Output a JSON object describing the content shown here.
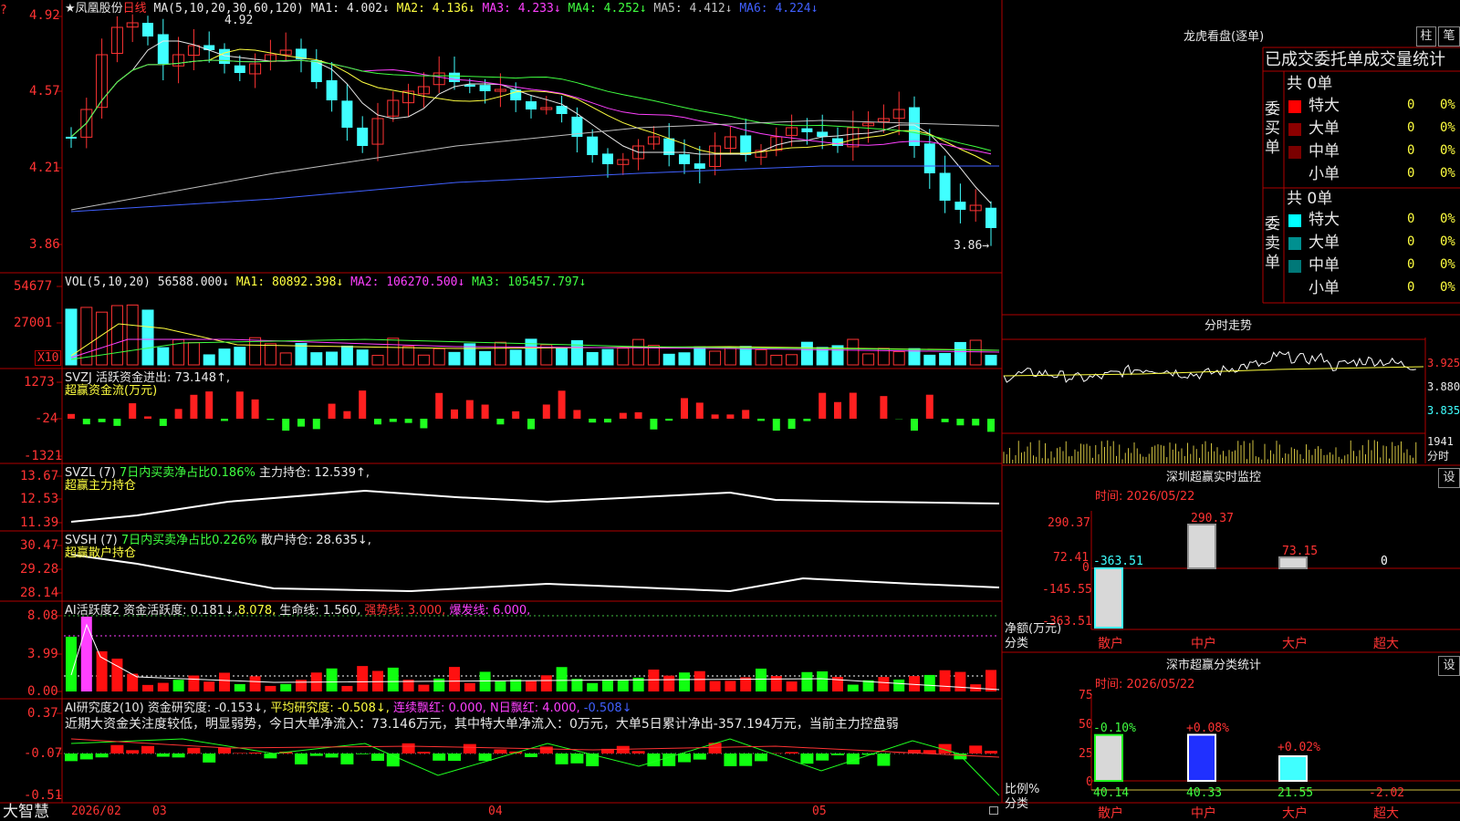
{
  "stock": {
    "title": "凤凰股份",
    "period": "日线",
    "star": "★",
    "ma_label": "MA(5,10,20,30,60,120)",
    "ma_values": [
      {
        "label": "MA1: 4.002↓",
        "color": "#e8e8e8"
      },
      {
        "label": "MA2: 4.136↓",
        "color": "#ffff40"
      },
      {
        "label": "MA3: 4.233↓",
        "color": "#ff40ff"
      },
      {
        "label": "MA4: 4.252↓",
        "color": "#40ff40"
      },
      {
        "label": "MA5: 4.412↓",
        "color": "#c0c0c0"
      },
      {
        "label": "MA6: 4.224↓",
        "color": "#4060ff"
      }
    ],
    "high_marker": "4.92",
    "low_marker": "3.86→",
    "price_axis": [
      "4.92",
      "4.57",
      "4.21",
      "3.86"
    ],
    "top_left_mark": "?"
  },
  "vol": {
    "label": "VOL(5,10,20)",
    "value": "56588.000↓",
    "ma1": "MA1: 80892.398↓",
    "ma2": "MA2: 106270.500↓",
    "ma3": "MA3: 105457.797↓",
    "axis": [
      "54677",
      "27001"
    ],
    "unit": "X10"
  },
  "svzj": {
    "label": "SVZJ  活跃资金进出: 73.148↑,",
    "sub": "超赢资金流(万元)",
    "axis": [
      "1273",
      "-24",
      "-1321"
    ]
  },
  "svzl": {
    "label": "SVZL (7)",
    "pct": "7日内买卖净占比0.186%",
    "hold": "主力持仓: 12.539↑,",
    "sub": "超赢主力持仓",
    "axis": [
      "13.67",
      "12.53",
      "11.39"
    ]
  },
  "svsh": {
    "label": "SVSH (7)",
    "pct": "7日内买卖净占比0.226%",
    "hold": "散户持仓: 28.635↓,",
    "sub": "超赢散户持仓",
    "axis": [
      "30.47",
      "29.28",
      "28.14"
    ]
  },
  "ai1": {
    "label": "AI活跃度2",
    "a": "资金活跃度: 0.181↓,",
    "b": "8.078,",
    "c": "生命线: 1.560,",
    "d": "强势线: 3.000,",
    "e": "爆发线: 6.000,",
    "axis": [
      "8.08",
      "3.99",
      "0.00"
    ]
  },
  "ai2": {
    "label": "AI研究度2(10)",
    "a": "资金研究度: -0.153↓,",
    "b": "平均研究度: -0.508↓,",
    "c": "连续飘红: 0.000,",
    "d": "N日飘红: 4.000,",
    "e": "-0.508↓",
    "note": "近期大资金关注度较低，明显弱势，今日大单净流入：73.146万元，其中特大单净流入：0万元，大单5日累计净出-357.194万元，当前主力控盘弱",
    "axis": [
      "0.37",
      "-0.07",
      "-0.51"
    ]
  },
  "bottom": {
    "brand": "大智慧",
    "dates": [
      "2026/02",
      "03",
      "04",
      "05"
    ]
  },
  "dragon": {
    "title": "龙虎看盘(逐单)",
    "btn1": "柱",
    "btn2": "笔",
    "subtitle": "已成交委托单成交量统计",
    "buy_label": "委买单",
    "sell_label": "委卖单",
    "buy_total": "共 0单",
    "sell_total": "共 0单",
    "buy_rows": [
      {
        "name": "特大",
        "count": "0",
        "pct": "0%",
        "color": "#ff0000"
      },
      {
        "name": "大单",
        "count": "0",
        "pct": "0%",
        "color": "#8b0000"
      },
      {
        "name": "中单",
        "count": "0",
        "pct": "0%",
        "color": "#7a0000"
      },
      {
        "name": "小单",
        "count": "0",
        "pct": "0%",
        "color": ""
      }
    ],
    "sell_rows": [
      {
        "name": "特大",
        "count": "0",
        "pct": "0%",
        "color": "#00ffff"
      },
      {
        "name": "大单",
        "count": "0",
        "pct": "0%",
        "color": "#009090"
      },
      {
        "name": "中单",
        "count": "0",
        "pct": "0%",
        "color": "#007878"
      },
      {
        "name": "小单",
        "count": "0",
        "pct": "0%",
        "color": ""
      }
    ]
  },
  "intraday": {
    "title": "分时走势",
    "axis": [
      "3.925",
      "3.880",
      "3.835"
    ],
    "vol_label": "1941",
    "vol_unit": "分时"
  },
  "monitor": {
    "title": "深圳超赢实时监控",
    "set": "设",
    "time": "时间: 2026/05/22",
    "axis": [
      "290.37",
      "72.41",
      "0",
      "-145.55",
      "-363.51"
    ],
    "bars": [
      {
        "cat": "散户",
        "value": -363.51,
        "label": "-363.51"
      },
      {
        "cat": "中户",
        "value": 290.37,
        "label": "290.37"
      },
      {
        "cat": "大户",
        "value": 73.15,
        "label": "73.15"
      },
      {
        "cat": "超大",
        "value": 0,
        "label": "0"
      }
    ],
    "ylabel": "净额(万元)",
    "xlabel": "分类"
  },
  "classify": {
    "title": "深市超赢分类统计",
    "set": "设",
    "time": "时间: 2026/05/22",
    "axis": [
      "75",
      "50",
      "25",
      "0"
    ],
    "bars": [
      {
        "cat": "散户",
        "value": 40.14,
        "label": "40.14",
        "chg": "-0.10%"
      },
      {
        "cat": "中户",
        "value": 40.33,
        "label": "40.33",
        "chg": "+0.08%"
      },
      {
        "cat": "大户",
        "value": 21.55,
        "label": "21.55",
        "chg": "+0.02%"
      },
      {
        "cat": "超大",
        "value": -2.02,
        "label": "-2.02",
        "chg": ""
      }
    ],
    "ylabel": "比例%",
    "xlabel": "分类"
  },
  "chart_data": [
    {
      "type": "bar",
      "title": "深圳超赢实时监控",
      "categories": [
        "散户",
        "中户",
        "大户",
        "超大"
      ],
      "values": [
        -363.51,
        290.37,
        73.15,
        0
      ],
      "ylabel": "净额(万元)",
      "xlabel": "分类",
      "ylim": [
        -363.51,
        290.37
      ]
    },
    {
      "type": "bar",
      "title": "深市超赢分类统计",
      "categories": [
        "散户",
        "中户",
        "大户",
        "超大"
      ],
      "values": [
        40.14,
        40.33,
        21.55,
        -2.02
      ],
      "ylabel": "比例%",
      "xlabel": "分类",
      "ylim": [
        0,
        75
      ]
    }
  ]
}
